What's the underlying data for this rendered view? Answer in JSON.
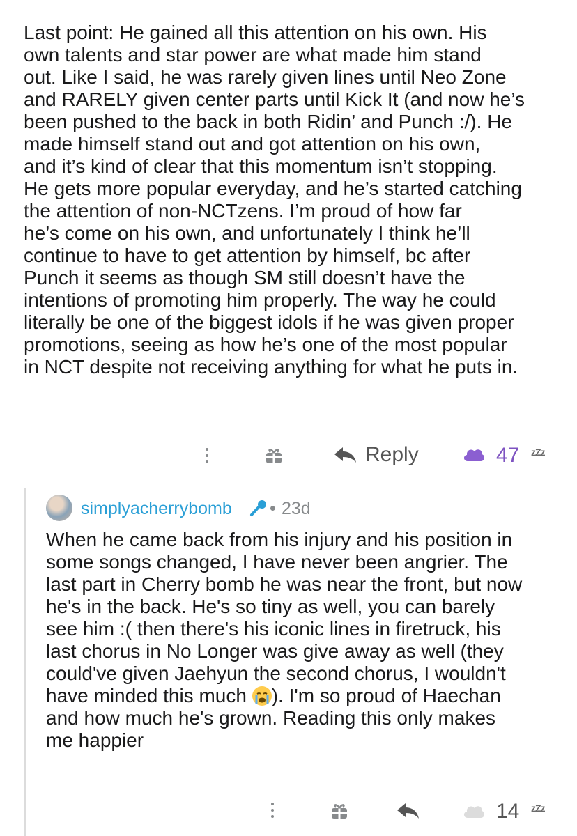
{
  "post": {
    "body": "Last point: He gained all this attention on his own.  His\nown talents and star power are what made him stand\nout.  Like I said, he was rarely given lines until Neo Zone\nand RARELY given center parts until Kick It (and now he’s\nbeen pushed to the back in both Ridin’ and Punch :/).  He\nmade himself stand out and got attention on his own,\nand it’s kind of clear that this momentum isn’t stopping.\nHe gets more popular everyday, and he’s started catching\nthe attention of non-NCTzens.  I’m proud of how far\nhe’s come on his own, and unfortunately I think he’ll\ncontinue to have to get attention by himself, bc after\nPunch it seems as though SM still doesn’t have the\nintentions of promoting him properly.  The way he could\nliterally be one of the biggest idols if he was given proper\npromotions, seeing as how he’s one of the most popular\nin NCT despite not receiving anything for what he puts in.",
    "actions": {
      "reply_label": "Reply",
      "votes": "47"
    }
  },
  "reply": {
    "username": "simplyacherrybomb",
    "separator": "•",
    "age": "23d",
    "body_before_emoji": "When he came back from his injury and his position in\nsome songs changed, I have never been angrier. The\nlast part in Cherry bomb he was near the front, but now\nhe's in the back. He's so tiny as well, you can barely\nsee him :( then there's his iconic lines in firetruck, his\nlast chorus in No Longer was give away as well (they\ncould've given Jaehyun the second chorus, I wouldn't\nhave minded this much ",
    "body_after_emoji": "). I'm so proud of Haechan\nand how much he's grown. Reading this only makes\nme happier",
    "actions": {
      "votes": "14"
    }
  },
  "icons": {
    "more": "more-vertical-icon",
    "award": "gift-award-icon",
    "reply": "reply-arrow-icon",
    "upvote_active": "purple-cloud-icon",
    "upvote": "cloud-icon",
    "downvote": "zzz-icon",
    "flair": "microphone-icon",
    "emoji": "crying-face-emoji"
  },
  "zzz_text": "zZz",
  "colors": {
    "upvoted": "#7e53c1",
    "link": "#2a9fd6",
    "muted": "#878a8c",
    "thread_line": "#dcdcdc"
  }
}
